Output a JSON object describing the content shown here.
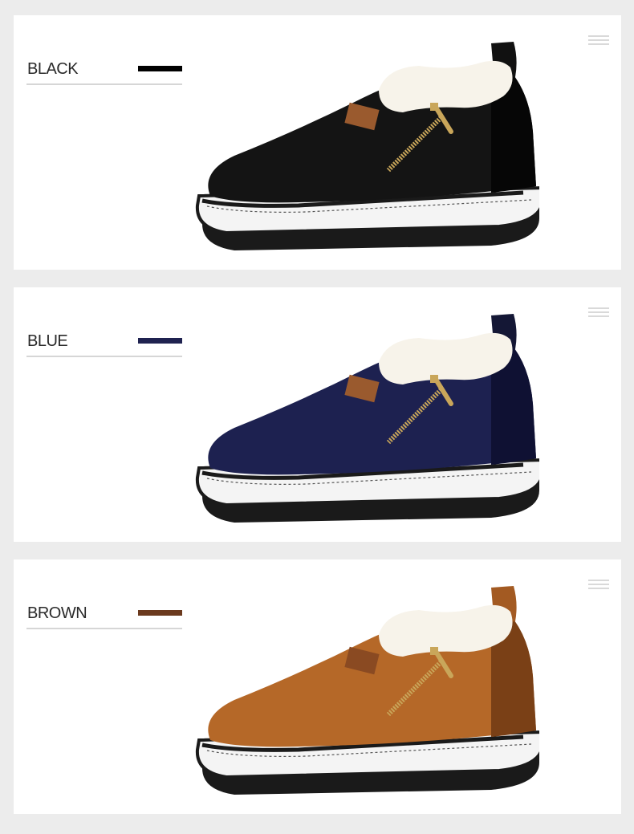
{
  "variants": [
    {
      "label": "BLACK",
      "swatch": "#000000",
      "upper": "#141414",
      "upper_dark": "#060606",
      "icon": "black-shoe-icon"
    },
    {
      "label": "BLUE",
      "swatch": "#1f2250",
      "upper": "#1d2150",
      "upper_dark": "#0f1133",
      "icon": "blue-shoe-icon"
    },
    {
      "label": "BROWN",
      "swatch": "#6b3a1e",
      "upper": "#b56828",
      "upper_dark": "#7a4016",
      "icon": "brown-shoe-icon"
    }
  ],
  "colors": {
    "background": "#ececec",
    "panel": "#ffffff",
    "underline": "#d6d6d6",
    "fur": "#f7f3ea",
    "sole_white": "#f4f4f4",
    "sole_black": "#1a1a1a",
    "zipper": "#c9a65a",
    "patch": "#9a5a2e"
  }
}
